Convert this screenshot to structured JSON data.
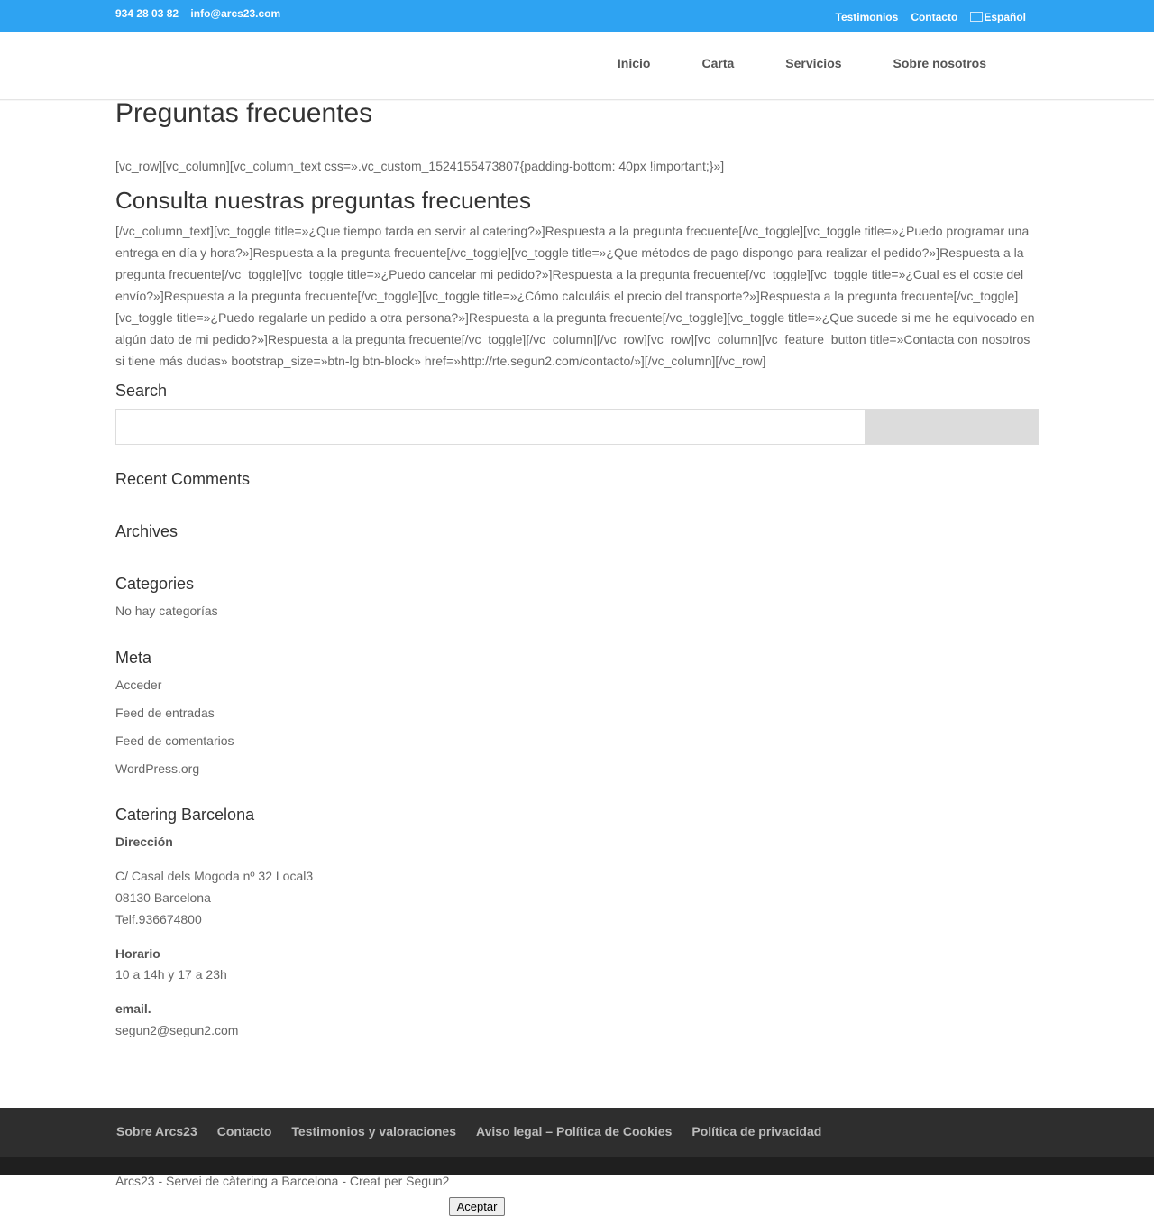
{
  "topbar": {
    "phone": "934 28 03 82",
    "email": "info@arcs23.com",
    "links": [
      "Testimonios",
      "Contacto"
    ],
    "language": "Español",
    "color": "#2ea3f2"
  },
  "nav": {
    "items": [
      "Inicio",
      "Carta",
      "Servicios",
      "Sobre nosotros"
    ]
  },
  "page": {
    "title": "Preguntas frecuentes",
    "shortcode_top": "[vc_row][vc_column][vc_column_text css=».vc_custom_1524155473807{padding-bottom: 40px !important;}»]",
    "subtitle": "Consulta nuestras preguntas frecuentes",
    "shortcode_body": "[/vc_column_text][vc_toggle title=»¿Que tiempo tarda en servir al catering?»]Respuesta a la pregunta frecuente[/vc_toggle][vc_toggle title=»¿Puedo programar una entrega en día y hora?»]Respuesta a la pregunta frecuente[/vc_toggle][vc_toggle title=»¿Que métodos de pago dispongo para realizar el pedido?»]Respuesta a la pregunta frecuente[/vc_toggle][vc_toggle title=»¿Puedo cancelar mi pedido?»]Respuesta a la pregunta frecuente[/vc_toggle][vc_toggle title=»¿Cual es el coste del envío?»]Respuesta a la pregunta frecuente[/vc_toggle][vc_toggle title=»¿Cómo calculáis el precio del transporte?»]Respuesta a la pregunta frecuente[/vc_toggle][vc_toggle title=»¿Puedo regalarle un pedido a otra persona?»]Respuesta a la pregunta frecuente[/vc_toggle][vc_toggle title=»¿Que sucede si me he equivocado en algún dato de mi pedido?»]Respuesta a la pregunta frecuente[/vc_toggle][/vc_column][/vc_row][vc_row][vc_column][vc_feature_button title=»Contacta con nosotros si tiene más dudas» bootstrap_size=»btn-lg btn-block» href=»http://rte.segun2.com/contacto/»][/vc_column][/vc_row]"
  },
  "sidebar": {
    "search_title": "Search",
    "search_value": "",
    "recent_comments_title": "Recent Comments",
    "archives_title": "Archives",
    "categories_title": "Categories",
    "categories_empty": "No hay categorías",
    "meta_title": "Meta",
    "meta_links": [
      "Acceder",
      "Feed de entradas",
      "Feed de comentarios",
      "WordPress.org"
    ],
    "info_title": "Catering Barcelona",
    "direccion_label": "Dirección",
    "address_line1": "C/ Casal dels Mogoda nº 32 Local3",
    "address_line2": "08130 Barcelona",
    "phone": "Telf.936674800",
    "horario_label": "Horario",
    "horario": "10 a 14h y 17 a 23h",
    "email_label": "email.",
    "email": "segun2@segun2.com"
  },
  "footer": {
    "links": [
      "Sobre Arcs23",
      "Contacto",
      "Testimonios y valoraciones",
      "Aviso legal – Política de Cookies",
      "Política de privacidad"
    ],
    "credits": "Arcs23 - Servei de càtering a Barcelona - Creat per Segun2",
    "accept_label": "Aceptar"
  }
}
